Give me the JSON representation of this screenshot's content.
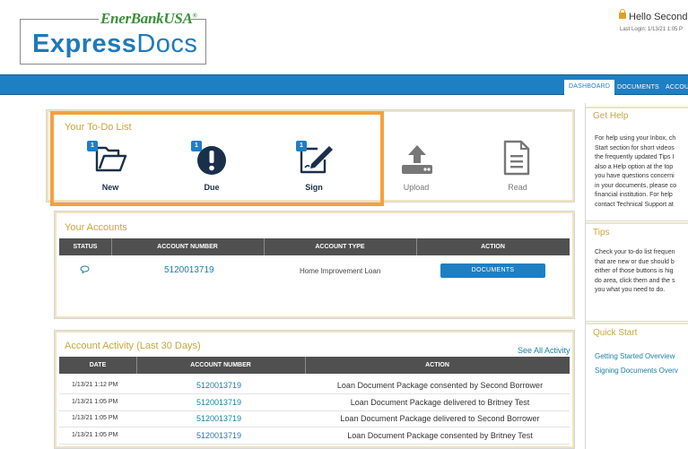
{
  "brand": {
    "enerbank": "EnerBankUSA",
    "express": "Express",
    "docs": "Docs"
  },
  "user": {
    "greeting": "Hello Second B",
    "last_login": "Last Login: 1/13/21 1:05 P"
  },
  "nav": {
    "tabs": [
      "DASHBOARD",
      "DOCUMENTS",
      "ACCOUN"
    ],
    "active": "DASHBOARD"
  },
  "todo": {
    "title": "Your To-Do List",
    "items": [
      {
        "label": "New",
        "badge": "1",
        "icon": "folder-open-icon"
      },
      {
        "label": "Due",
        "badge": "1",
        "icon": "alert-icon"
      },
      {
        "label": "Sign",
        "badge": "1",
        "icon": "sign-icon"
      },
      {
        "label": "Upload",
        "badge": "",
        "icon": "upload-icon"
      },
      {
        "label": "Read",
        "badge": "",
        "icon": "document-icon"
      }
    ]
  },
  "accounts": {
    "title": "Your Accounts",
    "columns": [
      "STATUS",
      "ACCOUNT NUMBER",
      "ACCOUNT TYPE",
      "ACTION"
    ],
    "rows": [
      {
        "account_number": "5120013719",
        "account_type": "Home Improvement Loan",
        "action": "DOCUMENTS"
      }
    ]
  },
  "activity": {
    "title": "Account Activity (Last 30 Days)",
    "see_all": "See All Activity",
    "columns": [
      "DATE",
      "ACCOUNT NUMBER",
      "ACTION"
    ],
    "rows": [
      {
        "date": "1/13/21 1:12 PM",
        "account": "5120013719",
        "action": "Loan Document Package consented by Second Borrower"
      },
      {
        "date": "1/13/21 1:05 PM",
        "account": "5120013719",
        "action": "Loan Document Package delivered to Britney Test"
      },
      {
        "date": "1/13/21 1:05 PM",
        "account": "5120013719",
        "action": "Loan Document Package delivered to Second Borrower"
      },
      {
        "date": "1/13/21 1:05 PM",
        "account": "5120013719",
        "action": "Loan Document Package consented by Britney Test"
      }
    ]
  },
  "side": {
    "help_title": "Get Help",
    "help_lines": [
      "For help using your Inbox, ch",
      "Start section for short videos",
      "the frequently updated Tips I",
      "also a Help option at the top",
      "you have questions concerni",
      "in your documents, please co",
      "financial institution. For help",
      "contact Technical Support at"
    ],
    "tips_title": "Tips",
    "tips_lines": [
      "Check your to-do list frequen",
      "that are new or due should b",
      "either of those buttons is hig",
      "do area, click them and the s",
      "you what you need to do."
    ],
    "quick_title": "Quick Start",
    "quick_links": [
      "Getting Started Overview",
      "Signing Documents Overv"
    ]
  },
  "colors": {
    "brand_blue": "#1e7fc3",
    "brand_green": "#3a8f3a",
    "highlight_orange": "#f7a03c",
    "section_gold": "#c9a53e"
  }
}
